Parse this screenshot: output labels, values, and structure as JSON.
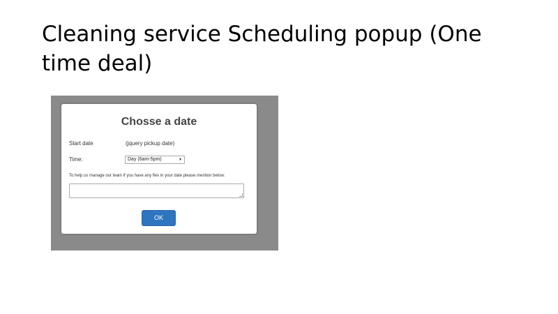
{
  "slide": {
    "title": "Cleaning service Scheduling popup (One time deal)"
  },
  "dialog": {
    "title": "Chosse a date",
    "start_date_label": "Start date",
    "start_date_value": "(jquery pickup date)",
    "time_label": "Time:",
    "time_selected": "Day (6am-5pm)",
    "help_text": "To help us manage our team if you have any flex in your date please mention below:",
    "notes_value": "",
    "ok_label": "OK"
  },
  "icons": {
    "select_arrow": "chevron-down-icon",
    "resize_grip": "resize-grip-icon"
  },
  "colors": {
    "overlay": "#8a8a8a",
    "ok_button": "#2e75c0"
  }
}
